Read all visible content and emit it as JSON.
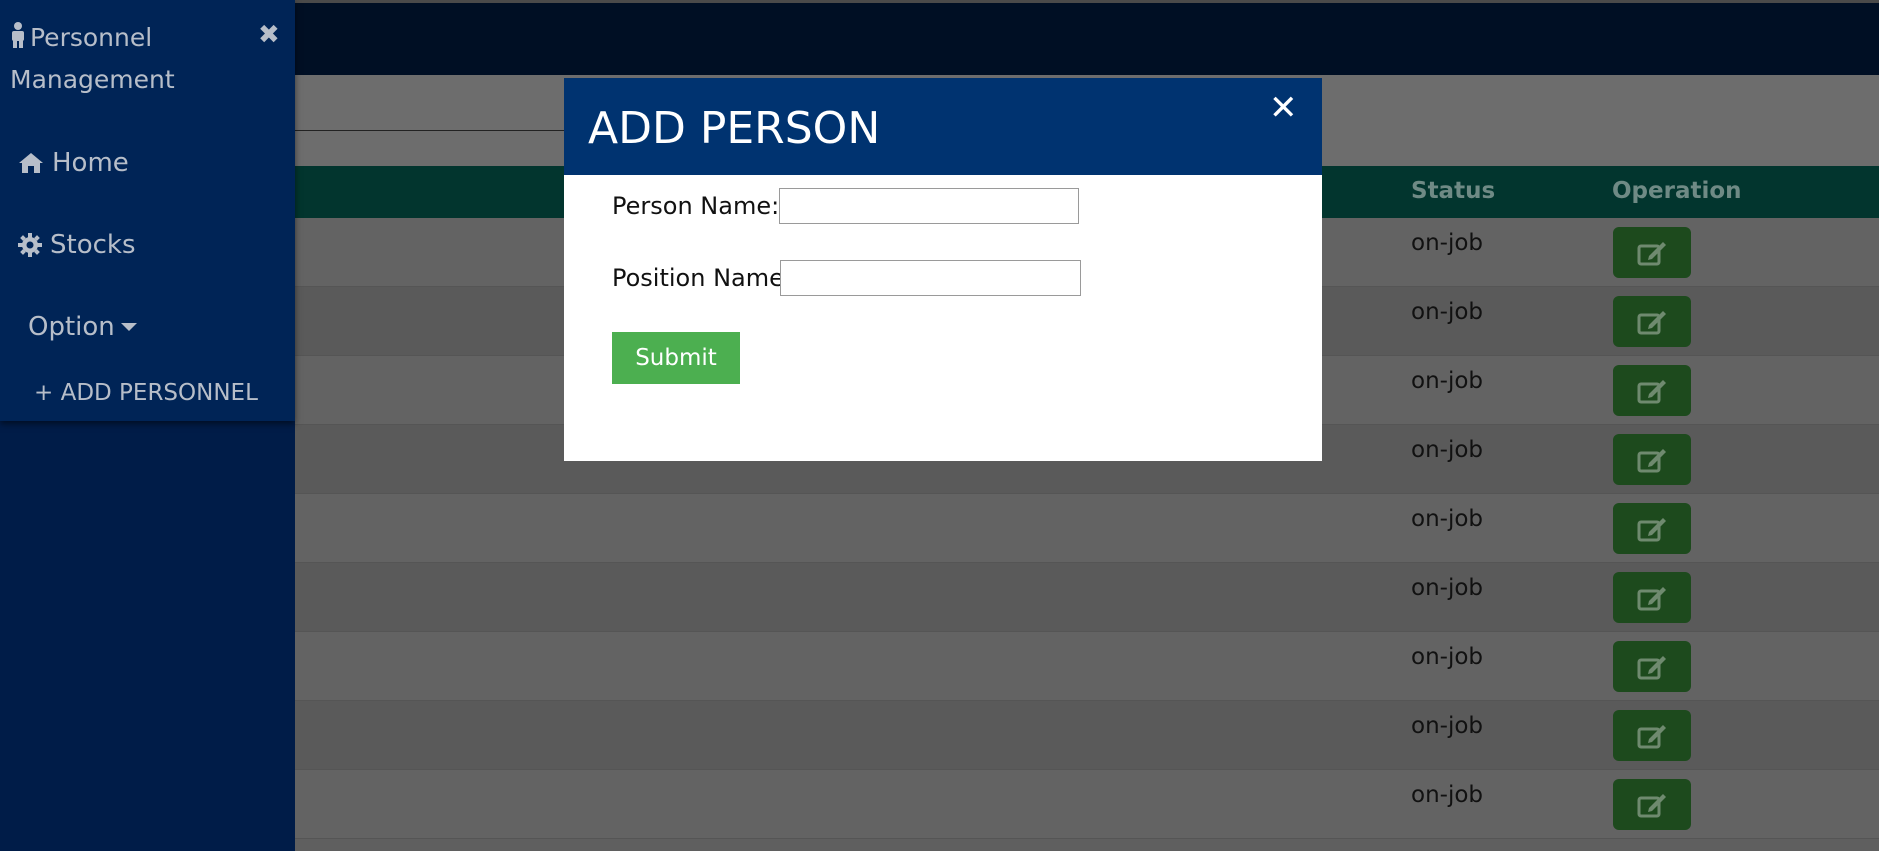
{
  "sidebar": {
    "brand": "Personnel Management",
    "brand_icon": "person-icon",
    "close_glyph": "✖",
    "items": [
      {
        "label": "Home",
        "icon": "home-icon"
      },
      {
        "label": "Stocks",
        "icon": "gear-icon"
      },
      {
        "label": "Option",
        "icon": "caret-down-icon"
      },
      {
        "label": "+ ADD PERSONNEL"
      }
    ]
  },
  "table": {
    "headers": {
      "status": "Status",
      "operation": "Operation"
    },
    "rows": [
      {
        "status": "on-job"
      },
      {
        "status": "on-job"
      },
      {
        "status": "on-job"
      },
      {
        "status": "on-job"
      },
      {
        "status": "on-job"
      },
      {
        "status": "on-job"
      },
      {
        "status": "on-job"
      },
      {
        "status": "on-job"
      },
      {
        "status": "on-job"
      }
    ],
    "edit_icon": "edit-icon"
  },
  "modal": {
    "title": "ADD PERSON",
    "close_glyph": "✕",
    "fields": {
      "person_name_label": "Person Name:",
      "person_name_value": "",
      "position_name_label": "Position Name",
      "position_name_value": ""
    },
    "submit_label": "Submit"
  },
  "colors": {
    "sidebar": "#001c48",
    "topbar": "#000f24",
    "table_header": "#02352e",
    "modal_header": "#003370",
    "submit": "#4caf50",
    "edit_button": "#1d4a1d"
  }
}
